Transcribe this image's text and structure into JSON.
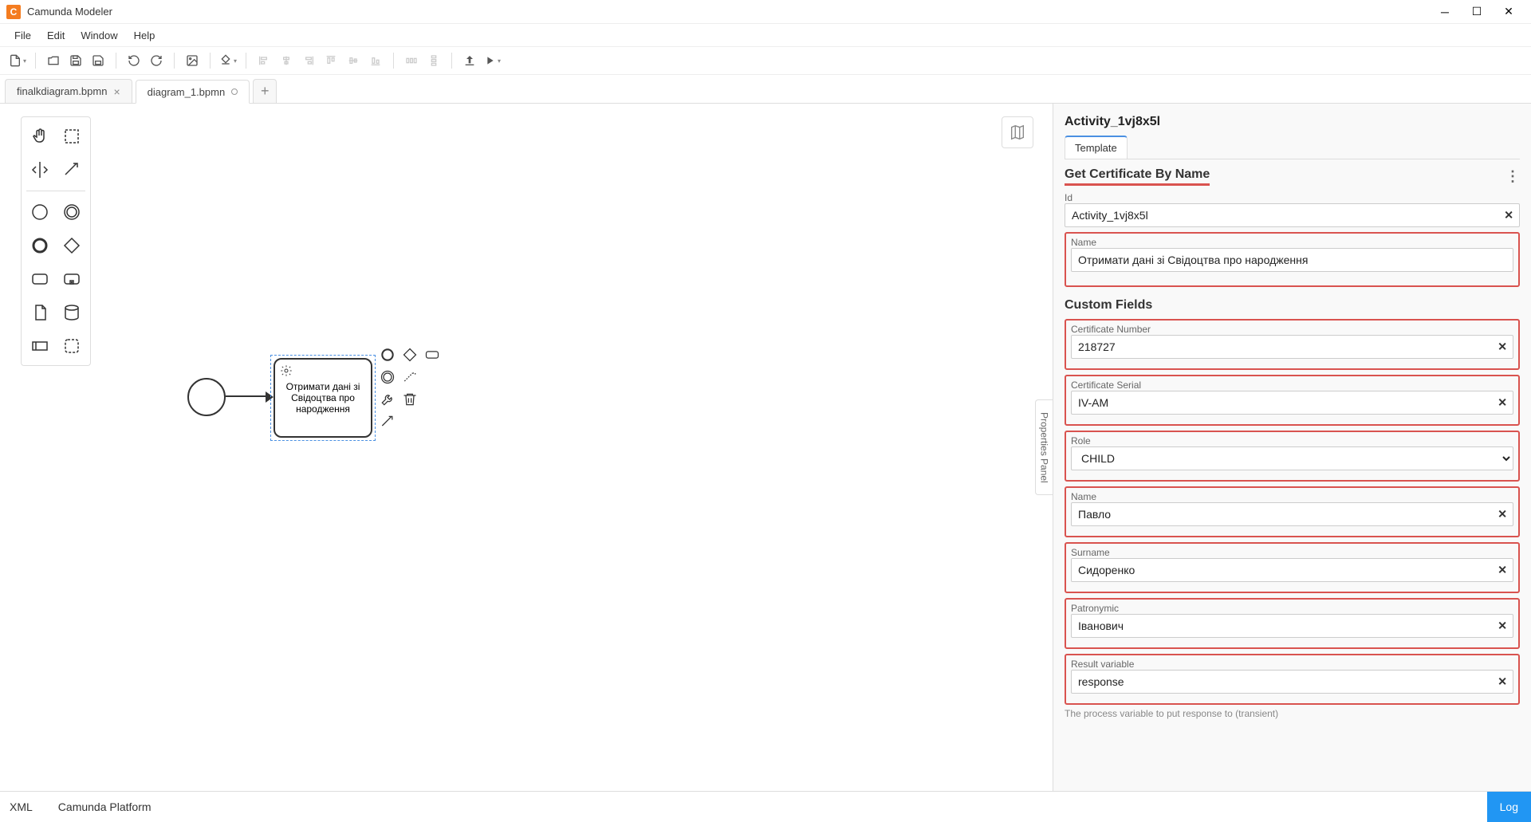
{
  "app": {
    "title": "Camunda Modeler"
  },
  "menu": {
    "items": [
      "File",
      "Edit",
      "Window",
      "Help"
    ]
  },
  "tabs": {
    "items": [
      {
        "label": "finalkdiagram.bpmn",
        "active": false,
        "dirty": false
      },
      {
        "label": "diagram_1.bpmn",
        "active": true,
        "dirty": true
      }
    ]
  },
  "canvas": {
    "task_label": "Отримати дані зі Свідоцтва про народження"
  },
  "panel_toggle": "Properties Panel",
  "properties": {
    "element_id": "Activity_1vj8x5l",
    "tab": "Template",
    "section_title": "Get Certificate By Name",
    "id_label": "Id",
    "id_value": "Activity_1vj8x5l",
    "name_label": "Name",
    "name_value": "Отримати дані зі Свідоцтва про народження",
    "custom_fields_title": "Custom Fields",
    "fields": {
      "cert_number_label": "Certificate Number",
      "cert_number_value": "218727",
      "cert_serial_label": "Certificate Serial",
      "cert_serial_value": "IV-AM",
      "role_label": "Role",
      "role_value": "CHILD",
      "pname_label": "Name",
      "pname_value": "Павло",
      "surname_label": "Surname",
      "surname_value": "Сидоренко",
      "patronymic_label": "Patronymic",
      "patronymic_value": "Іванович",
      "result_label": "Result variable",
      "result_value": "response",
      "result_helper": "The process variable to put response to (transient)"
    }
  },
  "statusbar": {
    "xml": "XML",
    "platform": "Camunda Platform",
    "log": "Log"
  }
}
